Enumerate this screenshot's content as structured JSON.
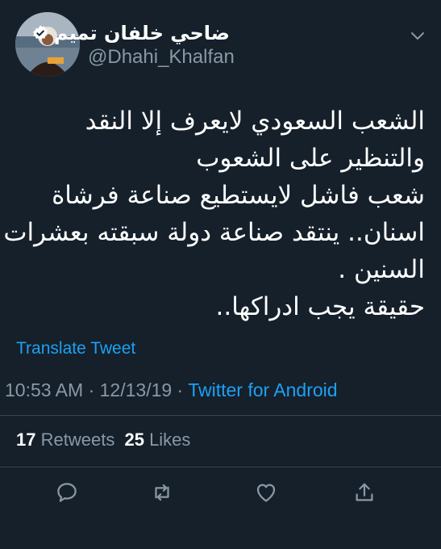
{
  "author": {
    "display_name": "ضاحي خلفان تميم",
    "handle": "@Dhahi_Khalfan",
    "verified": true,
    "avatar_icon": "person-photo"
  },
  "tweet": {
    "lines": [
      "الشعب السعودي لايعرف إلا النقد",
      "والتنظير على الشعوب",
      "شعب فاشل لايستطيع صناعة فرشاة",
      "اسنان.. ينتقد صناعة دولة سبقته بعشرات",
      "السنين .",
      "حقيقة يجب ادراكها.."
    ]
  },
  "translate_label": "Translate Tweet",
  "meta": {
    "time": "10:53 AM",
    "separator": " · ",
    "date": "12/13/19",
    "separator2": " · ",
    "source": "Twitter for Android"
  },
  "stats": {
    "retweets_count": "17",
    "retweets_label": "Retweets",
    "likes_count": "25",
    "likes_label": "Likes"
  },
  "icons": {
    "menu": "chevron-down-icon",
    "reply": "reply-icon",
    "retweet": "retweet-icon",
    "like": "heart-icon",
    "share": "share-icon"
  },
  "colors": {
    "background": "#15202b",
    "text": "#ffffff",
    "secondary": "#8899a6",
    "accent": "#1da1f2",
    "divider": "#38444d"
  }
}
